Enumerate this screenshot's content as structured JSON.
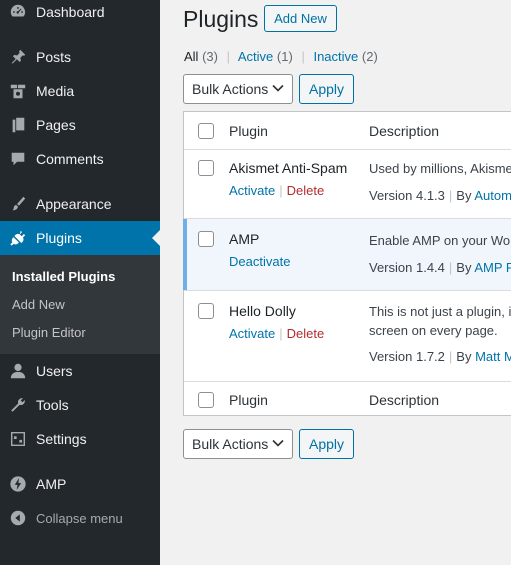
{
  "sidebar": {
    "items": [
      {
        "label": "Dashboard",
        "icon": "dashboard-icon"
      },
      {
        "label": "Posts",
        "icon": "pin-icon"
      },
      {
        "label": "Media",
        "icon": "media-icon"
      },
      {
        "label": "Pages",
        "icon": "pages-icon"
      },
      {
        "label": "Comments",
        "icon": "comment-icon"
      },
      {
        "label": "Appearance",
        "icon": "paintbrush-icon"
      },
      {
        "label": "Plugins",
        "icon": "plugin-icon"
      },
      {
        "label": "Users",
        "icon": "user-icon"
      },
      {
        "label": "Tools",
        "icon": "wrench-icon"
      },
      {
        "label": "Settings",
        "icon": "settings-sliders-icon"
      },
      {
        "label": "AMP",
        "icon": "amp-bolt-icon"
      },
      {
        "label": "Collapse menu",
        "icon": "collapse-arrow-icon"
      }
    ],
    "submenu": [
      {
        "label": "Installed Plugins"
      },
      {
        "label": "Add New"
      },
      {
        "label": "Plugin Editor"
      }
    ],
    "active_color": "#0073aa"
  },
  "header": {
    "title": "Plugins",
    "add_new": "Add New"
  },
  "filters": {
    "all": "All",
    "all_count": "(3)",
    "active": "Active",
    "active_count": "(1)",
    "inactive": "Inactive",
    "inactive_count": "(2)",
    "separator": "|"
  },
  "bulk": {
    "select_value": "Bulk Actions",
    "apply": "Apply"
  },
  "table": {
    "columns": [
      "Plugin",
      "Description"
    ],
    "rows": [
      {
        "name": "Akismet Anti-Spam",
        "actions": [
          "Activate",
          "Delete"
        ],
        "description": "Used by millions, Akismet",
        "version": "Version 4.1.3",
        "by": "By",
        "author": "Automa",
        "active": false
      },
      {
        "name": "AMP",
        "actions": [
          "Deactivate"
        ],
        "description": "Enable AMP on your Wor",
        "version": "Version 1.4.4",
        "by": "By",
        "author": "AMP Pr",
        "active": true
      },
      {
        "name": "Hello Dolly",
        "actions": [
          "Activate",
          "Delete"
        ],
        "description": "This is not just a plugin, it",
        "description_line2": "screen on every page.",
        "version": "Version 1.7.2",
        "by": "By",
        "author": "Matt M",
        "active": false
      }
    ]
  }
}
